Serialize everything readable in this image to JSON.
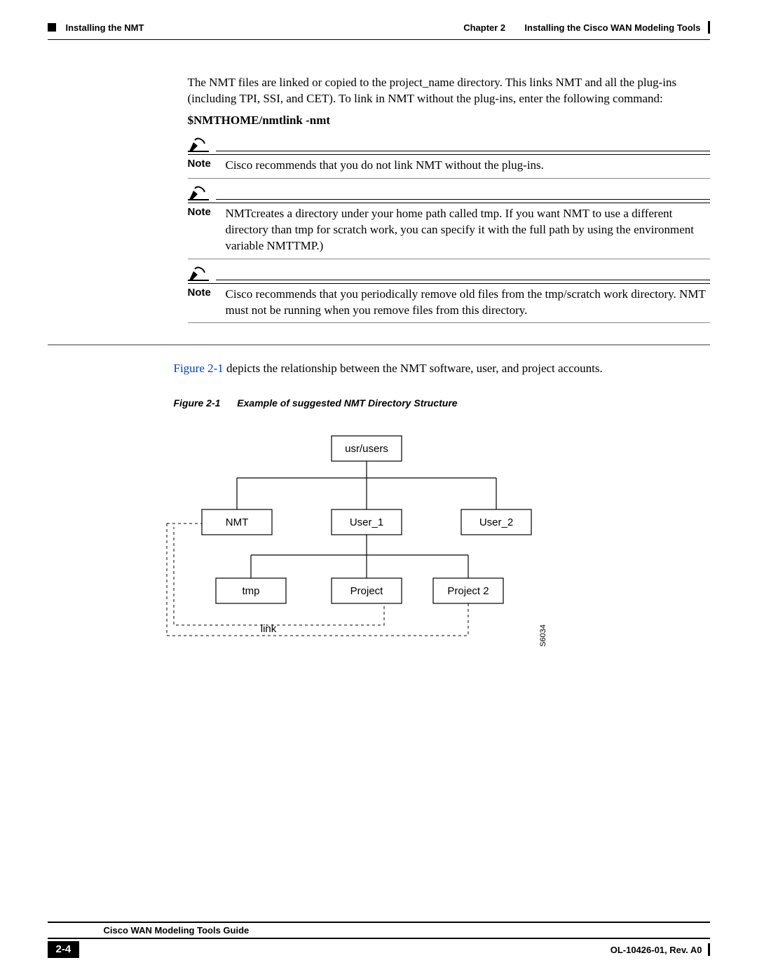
{
  "header": {
    "section": "Installing the NMT",
    "chapter": "Chapter 2",
    "chapter_title": "Installing the Cisco WAN Modeling Tools"
  },
  "body": {
    "intro": "The NMT files are linked or copied to the project_name directory. This links NMT and all the plug-ins (including TPI, SSI, and CET). To link in NMT without the plug-ins, enter the following command:",
    "command": "$NMTHOME/nmtlink -nmt",
    "notes": [
      "Cisco recommends that you do not link NMT without the plug-ins.",
      "NMTcreates a directory under your home path called tmp. If you want NMT to use a different directory than tmp for scratch work, you can specify it with the full path by using the environment variable NMTTMP.)",
      "Cisco recommends that you periodically remove old files from the tmp/scratch work directory. NMT must not be running when you remove files from this directory."
    ],
    "note_label": "Note",
    "fig_ref": "Figure 2-1",
    "fig_ref_rest": " depicts the relationship between the NMT software, user, and project accounts."
  },
  "figure": {
    "number": "Figure 2-1",
    "title": "Example of suggested NMT Directory Structure",
    "nodes": {
      "root": "usr/users",
      "nmt": "NMT",
      "user1": "User_1",
      "user2": "User_2",
      "tmp": "tmp",
      "project": "Project",
      "project2": "Project 2",
      "link_label": "link",
      "tag": "S6034"
    }
  },
  "footer": {
    "guide": "Cisco WAN Modeling Tools Guide",
    "page": "2-4",
    "pub": "OL-10426-01, Rev. A0"
  }
}
